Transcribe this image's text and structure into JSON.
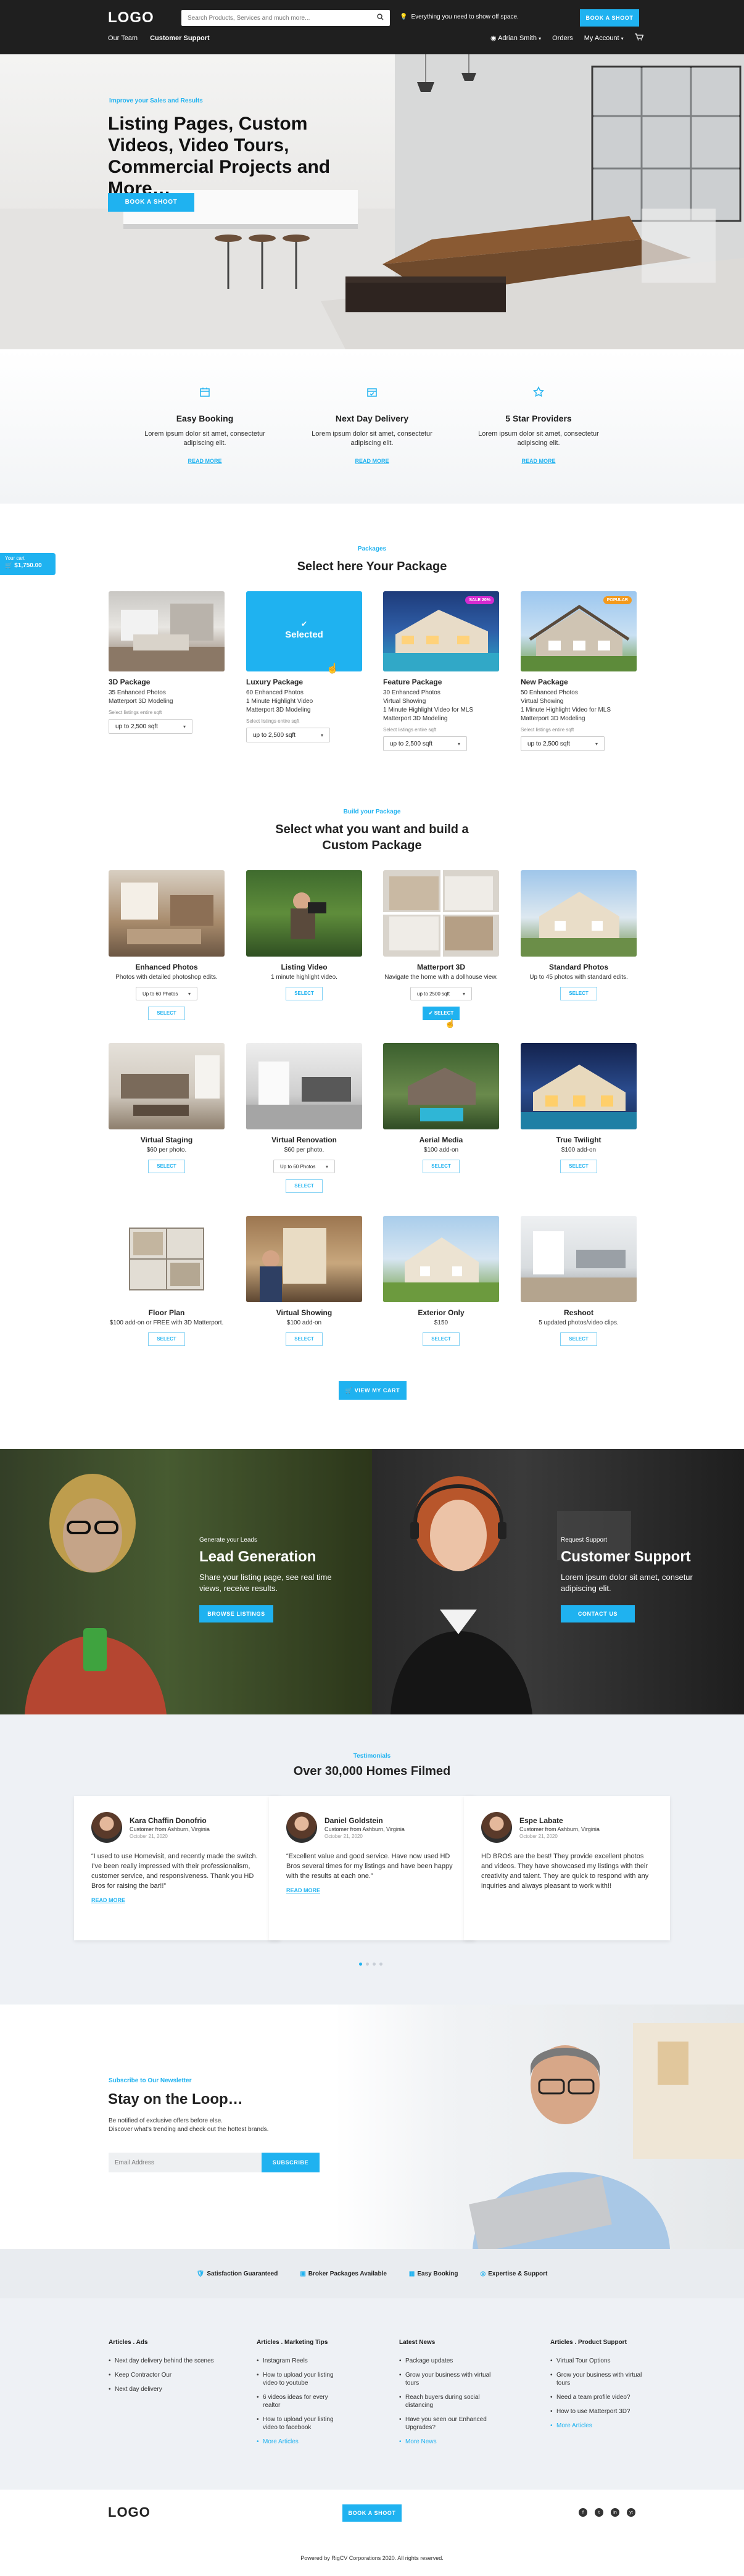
{
  "header": {
    "logo": "LOGO",
    "search_placeholder": "Search Products, Services and much more...",
    "promo": "Everything you need to show off space.",
    "book_button": "BOOK A SHOOT",
    "left_nav": [
      "Our Team",
      "Customer Support"
    ],
    "user": "Adrian Smith",
    "orders": "Orders",
    "account": "My Account"
  },
  "hero": {
    "eyebrow": "Improve your Sales and Results",
    "title": "Listing Pages, Custom Videos, Video Tours, Commercial Projects and More…",
    "button": "BOOK A SHOOT"
  },
  "features": [
    {
      "title": "Easy Booking",
      "text": "Lorem ipsum dolor sit amet, consectetur adipiscing elit.",
      "link": "READ MORE"
    },
    {
      "title": "Next Day Delivery",
      "text": "Lorem ipsum dolor sit amet, consectetur adipiscing elit.",
      "link": "READ MORE"
    },
    {
      "title": "5 Star Providers",
      "text": "Lorem ipsum dolor sit amet, consectetur adipiscing elit.",
      "link": "READ MORE"
    }
  ],
  "cart": {
    "label": "Your cart",
    "total": "$1,750.00"
  },
  "packages": {
    "eyebrow": "Packages",
    "title": "Select here Your Package",
    "items": [
      {
        "name": "3D Package",
        "features": [
          "35 Enhanced Photos",
          "Matterport 3D Modeling"
        ],
        "caption": "Select listings entire sqft",
        "size": "up to 2,500 sqft"
      },
      {
        "name": "Luxury Package",
        "features": [
          "60 Enhanced Photos",
          "1 Minute Highlight Video",
          "Matterport 3D Modeling"
        ],
        "caption": "Select listings entire sqft",
        "size": "up to 2,500 sqft",
        "overlay": "Selected"
      },
      {
        "name": "Feature Package",
        "features": [
          "30 Enhanced Photos",
          "Virtual Showing",
          "1 Minute Highlight Video for MLS",
          "Matterport 3D Modeling"
        ],
        "caption": "Select listings entire sqft",
        "size": "up to 2,500 sqft",
        "badge": "SALE 20%"
      },
      {
        "name": "New Package",
        "features": [
          "50 Enhanced Photos",
          "Virtual Showing",
          "1 Minute Highlight Video for MLS",
          "Matterport 3D Modeling"
        ],
        "caption": "Select listings entire sqft",
        "size": "up to 2,500 sqft",
        "badge": "POPULAR"
      }
    ]
  },
  "custom": {
    "eyebrow": "Build your Package",
    "title": "Select what you want and build a Custom Package",
    "select_label": "SELECT",
    "selected_label": "SELECT",
    "items": [
      {
        "name": "Enhanced Photos",
        "desc": "Photos with detailed photoshop edits.",
        "option": "Up to 60 Photos"
      },
      {
        "name": "Listing Video",
        "desc": "1 minute highlight video."
      },
      {
        "name": "Matterport 3D",
        "desc": "Navigate the home with a dollhouse view.",
        "option": "up to 2500 sqft"
      },
      {
        "name": "Standard Photos",
        "desc": "Up to 45 photos with standard edits."
      },
      {
        "name": "Virtual Staging",
        "desc": "$60 per photo."
      },
      {
        "name": "Virtual Renovation",
        "desc": "$60 per photo.",
        "option": "Up to 60 Photos"
      },
      {
        "name": "Aerial Media",
        "desc": "$100 add-on"
      },
      {
        "name": "True Twilight",
        "desc": "$100 add-on"
      },
      {
        "name": "Floor Plan",
        "desc": "$100 add-on or FREE with 3D Matterport."
      },
      {
        "name": "Virtual Showing",
        "desc": "$100 add-on"
      },
      {
        "name": "Exterior Only",
        "desc": "$150"
      },
      {
        "name": "Reshoot",
        "desc": "5 updated photos/video clips."
      }
    ],
    "cart_button": "VIEW MY CART"
  },
  "split": {
    "left": {
      "eyebrow": "Generate your Leads",
      "title": "Lead Generation",
      "text": "Share your listing page, see real time views, receive results.",
      "button": "BROWSE LISTINGS"
    },
    "right": {
      "eyebrow": "Request Support",
      "title": "Customer Support",
      "text": "Lorem ipsum dolor sit amet, consetur adipiscing elit.",
      "button": "CONTACT US"
    }
  },
  "testimonials": {
    "eyebrow": "Testimonials",
    "title": "Over 30,000 Homes Filmed",
    "items": [
      {
        "name": "Kara Chaffin Donofrio",
        "role": "Customer from Ashburn, Virginia",
        "date": "October 21, 2020",
        "quote": "“I used to use Homevisit, and recently made the switch. I’ve been really impressed with their professionalism, customer service, and responsiveness. Thank you HD Bros for raising the bar!!”",
        "link": "READ MORE"
      },
      {
        "name": "Daniel Goldstein",
        "role": "Customer from Ashburn, Virginia",
        "date": "October 21, 2020",
        "quote": "“Excellent value and good service. Have now used HD Bros several times for my listings and have been happy with the results at each one.”",
        "link": "READ MORE"
      },
      {
        "name": "Espe Labate",
        "role": "Customer from Ashburn, Virginia",
        "date": "October 21, 2020",
        "quote": "HD BROS are the best! They provide excellent photos and videos.  They have showcased my listings with their creativity and talent.  They are quick to respond with any inquiries and always pleasant to work with!!",
        "link": "READ MORE"
      }
    ]
  },
  "newsletter": {
    "eyebrow": "Subscribe to Our Newsletter",
    "title": "Stay on the Loop…",
    "line1": "Be notified of exclusive offers before else.",
    "line2": "Discover what’s trending and check out the hottest brands.",
    "placeholder": "Email Address",
    "button": "SUBSCRIBE"
  },
  "strip": [
    "Satisfaction Guaranteed",
    "Broker Packages Available",
    "Easy Booking",
    "Expertise & Support"
  ],
  "footer": {
    "columns": [
      {
        "title": "Articles . Ads",
        "items": [
          "Next day delivery behind the scenes",
          "Keep Contractor Our",
          "Next day delivery"
        ]
      },
      {
        "title": "Articles . Marketing Tips",
        "items": [
          "Instagram Reels",
          "How to upload your listing video to youtube",
          "6 videos ideas for every realtor",
          "How to upload your listing video to facebook",
          "More Articles"
        ]
      },
      {
        "title": "Latest News",
        "items": [
          "Package updates",
          "Grow your business with virtual tours",
          "Reach buyers during social distancing",
          "Have you seen our Enhanced Upgrades?",
          "More News"
        ]
      },
      {
        "title": "Articles . Product Support",
        "items": [
          "Virtual Tour Options",
          "Grow your business with virtual tours",
          "Need a team profile video?",
          "How to use Matterport 3D?",
          "More Articles"
        ]
      }
    ],
    "logo": "LOGO",
    "button": "BOOK A SHOOT",
    "social": [
      "f",
      "t",
      "in",
      "yt"
    ],
    "copyright": "Powered by RigCV Corporations 2020. All rights reserved."
  }
}
